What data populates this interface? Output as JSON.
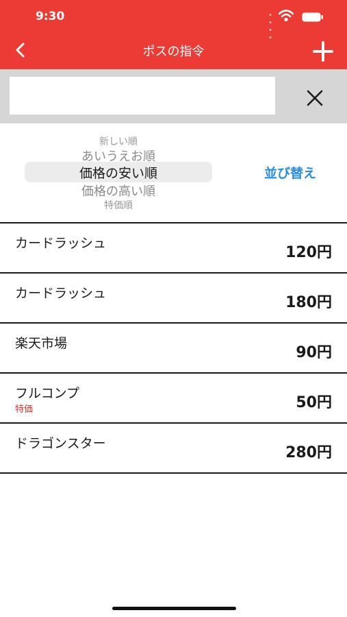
{
  "status_bar": {
    "time": "9:30"
  },
  "nav": {
    "title": "ポスの指令",
    "back_icon": "chevron-left-icon",
    "add_icon": "plus-icon"
  },
  "search": {
    "value": "",
    "placeholder": "",
    "clear_icon": "close-icon"
  },
  "sort": {
    "options": [
      "新しい順",
      "あいうえお順",
      "価格の安い順",
      "価格の高い順",
      "特価順"
    ],
    "selected": "価格の安い順",
    "button_label": "並び替え"
  },
  "items": [
    {
      "name": "カードラッシュ",
      "price": "120円",
      "badge": ""
    },
    {
      "name": "カードラッシュ",
      "price": "180円",
      "badge": ""
    },
    {
      "name": "楽天市場",
      "price": "90円",
      "badge": ""
    },
    {
      "name": "フルコンプ",
      "price": "50円",
      "badge": "特価"
    },
    {
      "name": "ドラゴンスター",
      "price": "280円",
      "badge": ""
    }
  ],
  "colors": {
    "header": "#ec3b34",
    "accent_blue": "#2a8de0",
    "badge_red": "#e0332c"
  }
}
